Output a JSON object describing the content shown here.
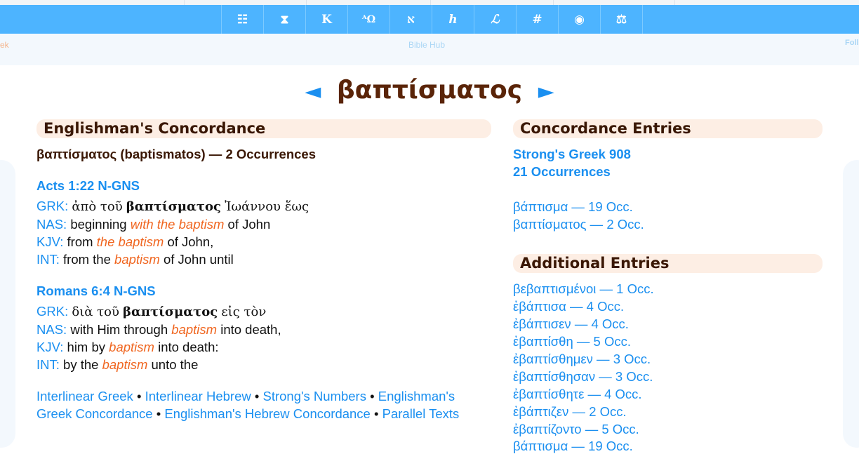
{
  "nav": {
    "icons": [
      "☷",
      "⧗",
      "K",
      "ᴬΩ",
      "א",
      "ℎ",
      "ℒ",
      "#",
      "◉",
      "⚖"
    ],
    "icon_names": [
      "menu-icon",
      "hourglass-icon",
      "kappa-icon",
      "alpha-omega-icon",
      "aleph-icon",
      "hebrew-icon",
      "lexicon-icon",
      "number-icon",
      "globe-icon",
      "scales-icon"
    ]
  },
  "subbar": {
    "left": "ek",
    "center": "Bible Hub",
    "right": "Foll"
  },
  "title": {
    "prev_arrow": "◄",
    "word": "βαπτίσματος",
    "next_arrow": "►"
  },
  "concordance": {
    "heading": "Englishman's Concordance",
    "summary": "βαπτίσματος (baptismatos) — 2 Occurrences",
    "entries": [
      {
        "ref": "Acts 1:22 N-GNS",
        "grk_label": "GRK:",
        "grk_pre": "ἀπὸ τοῦ",
        "grk_word": "βαπτίσματος",
        "grk_post": "Ἰωάννου ἕως",
        "nas_label": "NAS:",
        "nas_pre": "beginning",
        "nas_hl": "with the baptism",
        "nas_post": "of John",
        "kjv_label": "KJV:",
        "kjv_pre": "from",
        "kjv_hl": "the baptism",
        "kjv_post": "of John,",
        "int_label": "INT:",
        "int_pre": "from the",
        "int_hl": "baptism",
        "int_post": "of John until"
      },
      {
        "ref": "Romans 6:4 N-GNS",
        "grk_label": "GRK:",
        "grk_pre": "διὰ τοῦ",
        "grk_word": "βαπτίσματος",
        "grk_post": "εἰς τὸν",
        "nas_label": "NAS:",
        "nas_pre": "with Him through",
        "nas_hl": "baptism",
        "nas_post": "into death,",
        "kjv_label": "KJV:",
        "kjv_pre": "him by",
        "kjv_hl": "baptism",
        "kjv_post": "into death:",
        "int_label": "INT:",
        "int_pre": "by the",
        "int_hl": "baptism",
        "int_post": "unto the"
      }
    ],
    "links": {
      "interlinear_greek": "Interlinear Greek",
      "interlinear_hebrew": "Interlinear Hebrew",
      "strongs_numbers": "Strong's Numbers",
      "englishmans_greek_a": "Englishman's",
      "englishmans_greek_b": "Greek Concordance",
      "englishmans_hebrew": "Englishman's Hebrew Concordance",
      "parallel_texts": "Parallel Texts",
      "sep": "•"
    }
  },
  "entries_panel": {
    "heading": "Concordance Entries",
    "strongs": "Strong's Greek 908",
    "occurrences": "21 Occurrences",
    "items": [
      "βάπτισμα — 19 Occ.",
      "βαπτίσματος — 2 Occ."
    ]
  },
  "additional": {
    "heading": "Additional Entries",
    "items": [
      "βεβαπτισμένοι — 1 Occ.",
      "ἐβάπτισα — 4 Occ.",
      "ἐβάπτισεν — 4 Occ.",
      "ἐβαπτίσθη — 5 Occ.",
      "ἐβαπτίσθημεν — 3 Occ.",
      "ἐβαπτίσθησαν — 3 Occ.",
      "ἐβαπτίσθητε — 4 Occ.",
      "ἐβάπτιζεν — 2 Occ.",
      "ἐβαπτίζοντο — 5 Occ.",
      "βάπτισμα — 19 Occ."
    ]
  }
}
